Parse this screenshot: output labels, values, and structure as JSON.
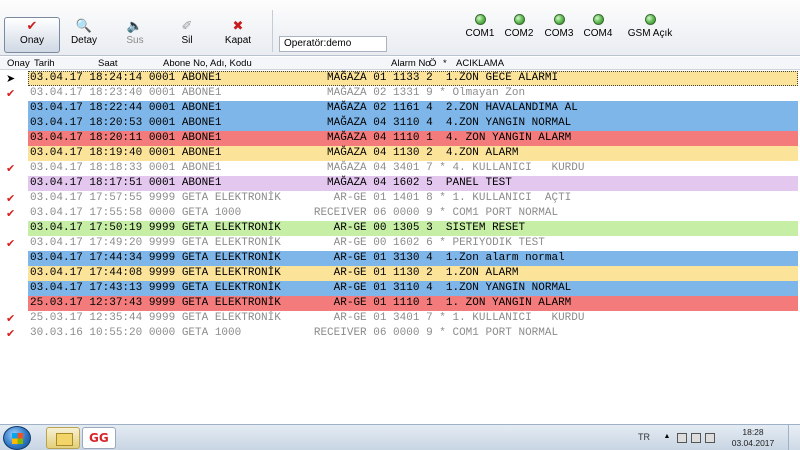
{
  "toolbar": {
    "buttons": [
      {
        "label": "Onay",
        "icon": "check-icon",
        "glyph": "✔",
        "color": "#cc1f1f"
      },
      {
        "label": "Detay",
        "icon": "magnifier-icon",
        "glyph": "🔍",
        "color": "#1f4f8a"
      },
      {
        "label": "Sus",
        "icon": "speaker-icon",
        "glyph": "🔈",
        "color": "#9a9a9a"
      },
      {
        "label": "Sil",
        "icon": "eraser-icon",
        "glyph": "✐",
        "color": "#9a9a9a"
      },
      {
        "label": "Kapat",
        "icon": "close-icon",
        "glyph": "✖",
        "color": "#c81c1c"
      }
    ],
    "operator": "Operatör:demo"
  },
  "ports": [
    {
      "label": "COM1",
      "icon": "green-led-icon"
    },
    {
      "label": "COM2",
      "icon": "green-led-icon"
    },
    {
      "label": "COM3",
      "icon": "green-led-icon"
    },
    {
      "label": "COM4",
      "icon": "green-led-icon"
    },
    {
      "label": "GSM Açık",
      "icon": "green-led-icon"
    }
  ],
  "grid": {
    "columns": [
      "Onay",
      "Tarih",
      "Saat",
      "Abone No, Adı, Kodu",
      "Alarm No",
      "Ö",
      "*",
      "ACIKLAMA"
    ],
    "rows": [
      {
        "mark": "arrow",
        "text": "03.04.17 18:24:14 0001 ABONE1                MAĞAZA 01 1133 2  1.ZON GECE ALARMI",
        "bg": "#fce39a",
        "fg": "#000000"
      },
      {
        "mark": "check",
        "text": "03.04.17 18:23:40 0001 ABONE1                MAĞAZA 02 1331 9 * Olmayan Zon",
        "bg": "#ffffff",
        "fg": "#8c8c8c"
      },
      {
        "mark": "",
        "text": "03.04.17 18:22:44 0001 ABONE1                MAĞAZA 02 1161 4  2.ZON HAVALANDIMA AL",
        "bg": "#7fb6ea",
        "fg": "#000000"
      },
      {
        "mark": "",
        "text": "03.04.17 18:20:53 0001 ABONE1                MAĞAZA 04 3110 4  4.ZON YANGIN NORMAL",
        "bg": "#7fb6ea",
        "fg": "#000000"
      },
      {
        "mark": "",
        "text": "03.04.17 18:20:11 0001 ABONE1                MAĞAZA 04 1110 1  4. ZON YANGIN ALARM",
        "bg": "#f47b7b",
        "fg": "#000000"
      },
      {
        "mark": "",
        "text": "03.04.17 18:19:40 0001 ABONE1                MAĞAZA 04 1130 2  4.ZON ALARM",
        "bg": "#fce39a",
        "fg": "#000000"
      },
      {
        "mark": "check",
        "text": "03.04.17 18:18:33 0001 ABONE1                MAĞAZA 04 3401 7 * 4. KULLANICI   KURDU",
        "bg": "#ffffff",
        "fg": "#8c8c8c"
      },
      {
        "mark": "",
        "text": "03.04.17 18:17:51 0001 ABONE1                MAĞAZA 04 1602 5  PANEL TEST",
        "bg": "#e4c7ef",
        "fg": "#000000"
      },
      {
        "mark": "check",
        "text": "03.04.17 17:57:55 9999 GETA ELEKTRONİK        AR-GE 01 1401 8 * 1. KULLANICI  AÇTI",
        "bg": "#ffffff",
        "fg": "#8c8c8c"
      },
      {
        "mark": "check",
        "text": "03.04.17 17:55:58 0000 GETA 1000           RECEIVER 06 0000 9 * COM1 PORT NORMAL",
        "bg": "#ffffff",
        "fg": "#8c8c8c"
      },
      {
        "mark": "",
        "text": "03.04.17 17:50:19 9999 GETA ELEKTRONİK        AR-GE 00 1305 3  SISTEM RESET",
        "bg": "#c6eea4",
        "fg": "#000000"
      },
      {
        "mark": "check",
        "text": "03.04.17 17:49:20 9999 GETA ELEKTRONİK        AR-GE 00 1602 6 * PERIYODIK TEST",
        "bg": "#ffffff",
        "fg": "#8c8c8c"
      },
      {
        "mark": "",
        "text": "03.04.17 17:44:34 9999 GETA ELEKTRONİK        AR-GE 01 3130 4  1.Zon alarm normal",
        "bg": "#7fb6ea",
        "fg": "#000000"
      },
      {
        "mark": "",
        "text": "03.04.17 17:44:08 9999 GETA ELEKTRONİK        AR-GE 01 1130 2  1.ZON ALARM",
        "bg": "#fce39a",
        "fg": "#000000"
      },
      {
        "mark": "",
        "text": "03.04.17 17:43:13 9999 GETA ELEKTRONİK        AR-GE 01 3110 4  1.ZON YANGIN NORMAL",
        "bg": "#7fb6ea",
        "fg": "#000000"
      },
      {
        "mark": "",
        "text": "25.03.17 12:37:43 9999 GETA ELEKTRONİK        AR-GE 01 1110 1  1. ZON YANGIN ALARM",
        "bg": "#f47b7b",
        "fg": "#000000"
      },
      {
        "mark": "check",
        "text": "25.03.17 12:35:44 9999 GETA ELEKTRONİK        AR-GE 01 3401 7 * 1. KULLANICI   KURDU",
        "bg": "#ffffff",
        "fg": "#8c8c8c"
      },
      {
        "mark": "check",
        "text": "30.03.16 10:55:20 0000 GETA 1000           RECEIVER 06 0000 9 * COM1 PORT NORMAL",
        "bg": "#ffffff",
        "fg": "#8c8c8c"
      }
    ]
  },
  "taskbar": {
    "lang": "TR",
    "time": "18:28",
    "date": "03.04.2017",
    "apps": [
      "explorer-icon",
      "geta-app-icon"
    ],
    "app_logo_text": "GG"
  }
}
